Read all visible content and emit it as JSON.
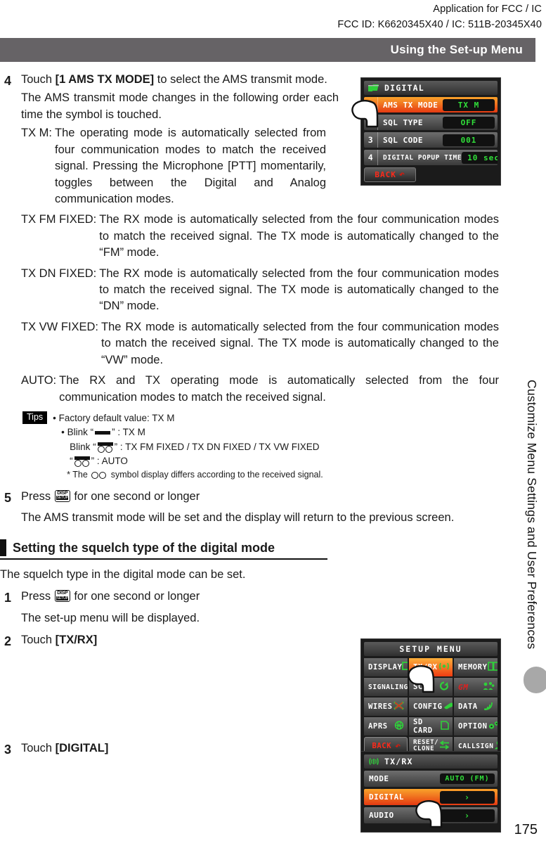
{
  "header": {
    "line1": "Application for FCC / IC",
    "line2": "FCC ID: K6620345X40 / IC: 511B-20345X40"
  },
  "title_bar": {
    "text": "Using the Set-up Menu"
  },
  "steps": {
    "s4": {
      "num": "4",
      "l1_pre": "Touch ",
      "l1_bold": "[1 AMS TX MODE]",
      "l1_post": " to select the AMS transmit mode.",
      "l2": "The AMS transmit mode changes in the following order each time the symbol is touched.",
      "defs": [
        {
          "term": "TX M:",
          "body": "The operating mode is automatically selected from four communication modes to match the received signal. Pressing the Microphone [PTT] momentarily, toggles between the Digital and Analog communication modes."
        },
        {
          "term": "TX FM FIXED:",
          "body": "The RX mode is automatically selected from the four communication modes to match the received signal. The TX mode is automatically changed to the “FM” mode."
        },
        {
          "term": "TX DN FIXED:",
          "body": "The RX mode is automatically selected from the four communication modes to match the received signal. The TX mode is automatically changed to the “DN” mode."
        },
        {
          "term": "TX VW FIXED:",
          "body": "The RX mode is automatically selected from the four communication modes to match the received signal. The TX mode is automatically changed to the “VW” mode."
        },
        {
          "term": "AUTO:",
          "body": "The RX and TX operating mode is automatically selected from the four communication modes to match the received signal."
        }
      ]
    },
    "s5": {
      "num": "5",
      "l1_pre": "Press ",
      "l1_post": " for one second or longer",
      "l2": "The AMS transmit mode will be set and the display will return to the previous screen."
    },
    "s1": {
      "num": "1",
      "l1_pre": "Press ",
      "l1_post": " for one second or longer",
      "l2": "The set-up menu will be displayed."
    },
    "s2": {
      "num": "2",
      "l1_pre": "Touch ",
      "l1_bold": "[TX/RX]"
    },
    "s3": {
      "num": "3",
      "l1_pre": "Touch ",
      "l1_bold": "[DIGITAL]"
    }
  },
  "tips": {
    "badge": "Tips",
    "line1": "• Factory default value: TX M",
    "line2_pre": "• Blink “",
    "line2_post": "” : TX M",
    "line3_pre": "Blink “",
    "line3_post": "” : TX FM FIXED / TX DN FIXED / TX VW FIXED",
    "line4_pre": "“",
    "line4_post": "” : AUTO",
    "line5_pre": "* The ",
    "line5_post": " symbol display differs according to the received signal."
  },
  "section_heading": {
    "text": "Setting the squelch type of the digital mode"
  },
  "section_intro": {
    "text": "The squelch type in the digital mode can be set."
  },
  "disp_key": {
    "top": "DISP",
    "bottom": "SETUP"
  },
  "side_tab": {
    "text": "Customize Menu Settings and User Preferences"
  },
  "page_number": "175",
  "devices": {
    "digital": {
      "title": "DIGITAL",
      "icon": "digital-transceiver-icon",
      "rows": [
        {
          "idx": "1",
          "label": "AMS  TX  MODE",
          "value": "TX M",
          "highlight": true
        },
        {
          "idx": "2",
          "label": "SQL  TYPE",
          "value": "OFF",
          "highlight": false
        },
        {
          "idx": "3",
          "label": "SQL  CODE",
          "value": "001",
          "highlight": false
        },
        {
          "idx": "4",
          "label": "DIGITAL POPUP TIME",
          "value": "10 sec",
          "highlight": false
        }
      ],
      "back_label": "BACK"
    },
    "setup_menu": {
      "title": "SETUP MENU",
      "cells": [
        {
          "label": "DISPLAY",
          "icon": "monitor-icon",
          "highlight": false
        },
        {
          "label": "TX/RX",
          "icon": "antenna-icon",
          "highlight": true
        },
        {
          "label": "MEMORY",
          "icon": "book-icon",
          "highlight": false
        },
        {
          "label": "SIGNALING",
          "icon": "bars-icon",
          "highlight": false
        },
        {
          "label": "SCAN",
          "icon": "refresh-icon",
          "highlight": false
        },
        {
          "label": "GM",
          "icon": "group-icon",
          "highlight": false
        },
        {
          "label": "WIRES",
          "icon": "x-node-icon",
          "highlight": false
        },
        {
          "label": "CONFIG",
          "icon": "wrench-icon",
          "highlight": false
        },
        {
          "label": "DATA",
          "icon": "wifi-icon",
          "highlight": false
        },
        {
          "label": "APRS",
          "icon": "globe-a-icon",
          "highlight": false
        },
        {
          "label": "SD  CARD",
          "icon": "sdcard-icon",
          "highlight": false
        },
        {
          "label": "OPTION",
          "icon": "gears-icon",
          "highlight": false
        },
        {
          "label": "BACK",
          "icon": "back-arrow-icon",
          "highlight": false
        },
        {
          "label": "RESET/\nCLONE",
          "icon": "swap-icon",
          "highlight": false
        },
        {
          "label": "CALLSIGN",
          "icon": "person-icon",
          "highlight": false
        }
      ]
    },
    "txrx": {
      "title": "TX/RX",
      "icon": "antenna-signal-icon",
      "rows": [
        {
          "label": "MODE",
          "value": "AUTO (FM)",
          "highlight": false
        },
        {
          "label": "DIGITAL",
          "value": "›",
          "highlight": true
        },
        {
          "label": "AUDIO",
          "value": "›",
          "highlight": false
        }
      ]
    }
  },
  "colors": {
    "title_bar_bg": "#666366",
    "highlight_orange": "#ef3c12",
    "screen_green": "#31e03a",
    "back_red": "#ff2a1a",
    "side_pill": "#a8a8a8"
  }
}
